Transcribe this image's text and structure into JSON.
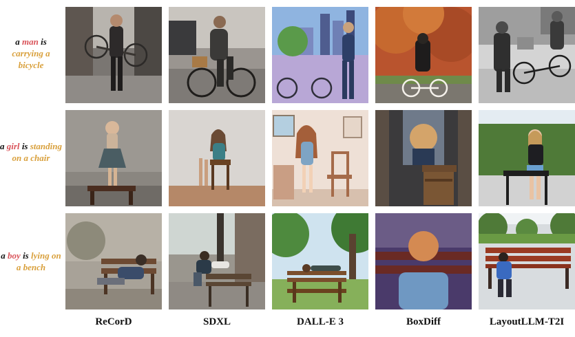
{
  "prompts": [
    {
      "pre": "a ",
      "subject": "man",
      "mid": " is ",
      "action": "carrying a bicycle",
      "post": ""
    },
    {
      "pre": "a ",
      "subject": "girl",
      "mid": " is ",
      "action": "standing on a chair",
      "post": ""
    },
    {
      "pre": "a ",
      "subject": "boy",
      "mid": " is ",
      "action": "lying on a bench",
      "post": ""
    }
  ],
  "methods": [
    "ReCorD",
    "SDXL",
    "DALL-E 3",
    "BoxDiff",
    "LayoutLLM-T2I"
  ],
  "colors": {
    "subject": "#d9545a",
    "action": "#d9a03c",
    "text": "#111111"
  }
}
